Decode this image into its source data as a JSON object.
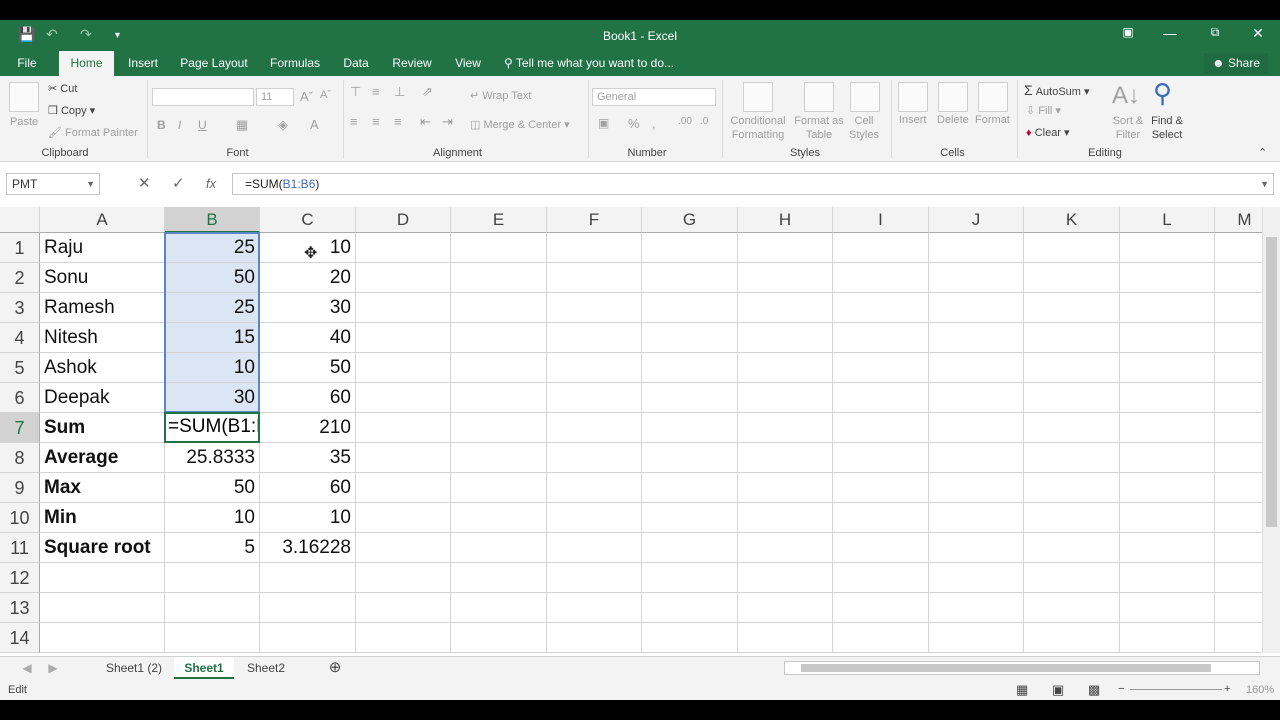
{
  "window": {
    "title": "Book1 - Excel"
  },
  "tabs": [
    "File",
    "Home",
    "Insert",
    "Page Layout",
    "Formulas",
    "Data",
    "Review",
    "View"
  ],
  "tell_me": "Tell me what you want to do...",
  "share": "Share",
  "ribbon": {
    "clipboard": {
      "paste": "Paste",
      "cut": "Cut",
      "copy": "Copy",
      "format_painter": "Format Painter",
      "label": "Clipboard"
    },
    "font": {
      "size": "11",
      "label": "Font"
    },
    "alignment": {
      "wrap": "Wrap Text",
      "merge": "Merge & Center",
      "label": "Alignment"
    },
    "number": {
      "format": "General",
      "label": "Number"
    },
    "styles": {
      "conditional": "Conditional",
      "conditional2": "Formatting",
      "format_as": "Format as",
      "table": "Table",
      "cell": "Cell",
      "styles": "Styles",
      "label": "Styles"
    },
    "cells": {
      "insert": "Insert",
      "delete": "Delete",
      "format": "Format",
      "label": "Cells"
    },
    "editing": {
      "autosum": "AutoSum",
      "fill": "Fill",
      "clear": "Clear",
      "sort": "Sort &",
      "filter": "Filter",
      "find": "Find &",
      "select": "Select",
      "label": "Editing"
    }
  },
  "formula_bar": {
    "name_box": "PMT",
    "formula_prefix": "=SUM(",
    "formula_ref": "B1:B6",
    "formula_suffix": ")"
  },
  "columns": [
    "A",
    "B",
    "C",
    "D",
    "E",
    "F",
    "G",
    "H",
    "I",
    "J",
    "K",
    "L",
    "M"
  ],
  "rows": [
    {
      "n": "1",
      "a": "Raju",
      "b": "25",
      "c": "10",
      "bold": false
    },
    {
      "n": "2",
      "a": "Sonu",
      "b": "50",
      "c": "20",
      "bold": false
    },
    {
      "n": "3",
      "a": "Ramesh",
      "b": "25",
      "c": "30",
      "bold": false
    },
    {
      "n": "4",
      "a": "Nitesh",
      "b": "15",
      "c": "40",
      "bold": false
    },
    {
      "n": "5",
      "a": "Ashok",
      "b": "10",
      "c": "50",
      "bold": false
    },
    {
      "n": "6",
      "a": "Deepak",
      "b": "30",
      "c": "60",
      "bold": false
    },
    {
      "n": "7",
      "a": "Sum",
      "b": "",
      "c": "210",
      "bold": true
    },
    {
      "n": "8",
      "a": "Average",
      "b": "25.8333",
      "c": "35",
      "bold": true
    },
    {
      "n": "9",
      "a": "Max",
      "b": "50",
      "c": "60",
      "bold": true
    },
    {
      "n": "10",
      "a": "Min",
      "b": "10",
      "c": "10",
      "bold": true
    },
    {
      "n": "11",
      "a": "Square root",
      "b": "5",
      "c": "3.16228",
      "bold": true
    },
    {
      "n": "12",
      "a": "",
      "b": "",
      "c": "",
      "bold": false
    },
    {
      "n": "13",
      "a": "",
      "b": "",
      "c": "",
      "bold": false
    },
    {
      "n": "14",
      "a": "",
      "b": "",
      "c": "",
      "bold": false
    }
  ],
  "active_cell_text": "=SUM(B1:B6)",
  "sheets": [
    "Sheet1 (2)",
    "Sheet1",
    "Sheet2"
  ],
  "status": {
    "mode": "Edit",
    "zoom": "160%"
  }
}
